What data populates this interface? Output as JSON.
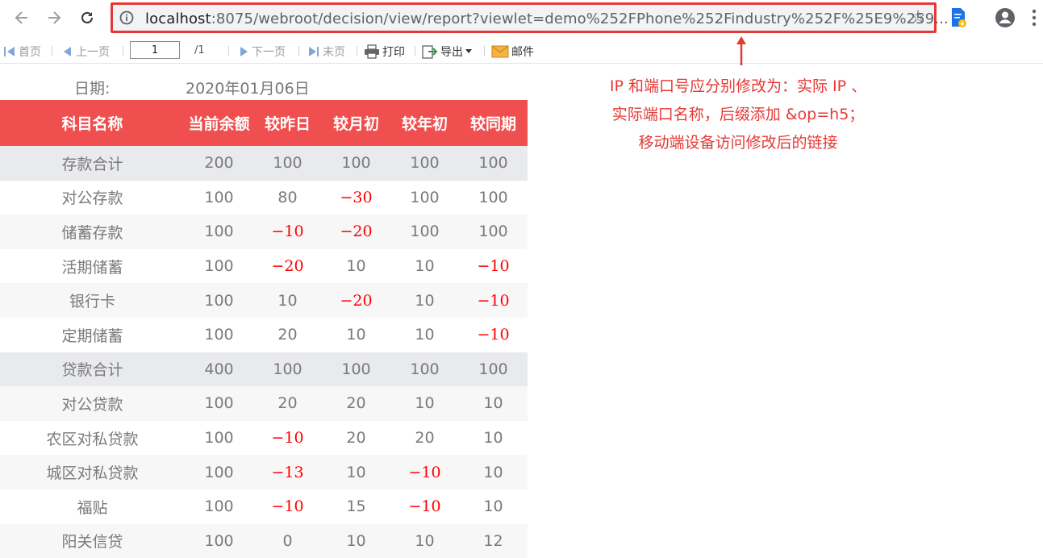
{
  "browser": {
    "url_host": "localhost",
    "url_rest": ":8075/webroot/decision/view/report?viewlet=demo%252FPhone%252Findustry%252F%25E9%259..."
  },
  "toolbar": {
    "first": "首页",
    "prev": "上一页",
    "page_value": "1",
    "page_total": "/1",
    "next": "下一页",
    "last": "末页",
    "print": "打印",
    "export": "导出",
    "mail": "邮件"
  },
  "report": {
    "date_label": "日期:",
    "date_value": "2020年01月06日",
    "columns": [
      "科目名称",
      "当前余额",
      "较昨日",
      "较月初",
      "较年初",
      "较同期"
    ],
    "rows": [
      {
        "type": "total",
        "name": "存款合计",
        "values": [
          "200",
          "100",
          "100",
          "100",
          "100"
        ],
        "neg": [
          false,
          false,
          false,
          false,
          false
        ]
      },
      {
        "type": "even",
        "name": "对公存款",
        "values": [
          "100",
          "80",
          "−30",
          "100",
          "100"
        ],
        "neg": [
          false,
          false,
          true,
          false,
          false
        ]
      },
      {
        "type": "odd",
        "name": "储蓄存款",
        "values": [
          "100",
          "−10",
          "−20",
          "100",
          "100"
        ],
        "neg": [
          false,
          true,
          true,
          false,
          false
        ]
      },
      {
        "type": "even",
        "name": "活期储蓄",
        "values": [
          "100",
          "−20",
          "10",
          "10",
          "−10"
        ],
        "neg": [
          false,
          true,
          false,
          false,
          true
        ]
      },
      {
        "type": "odd",
        "name": "银行卡",
        "values": [
          "100",
          "10",
          "−20",
          "10",
          "−10"
        ],
        "neg": [
          false,
          false,
          true,
          false,
          true
        ]
      },
      {
        "type": "even",
        "name": "定期储蓄",
        "values": [
          "100",
          "20",
          "10",
          "10",
          "−10"
        ],
        "neg": [
          false,
          false,
          false,
          false,
          true
        ]
      },
      {
        "type": "total",
        "name": "贷款合计",
        "values": [
          "400",
          "100",
          "100",
          "100",
          "100"
        ],
        "neg": [
          false,
          false,
          false,
          false,
          false
        ]
      },
      {
        "type": "odd",
        "name": "对公贷款",
        "values": [
          "100",
          "20",
          "20",
          "10",
          "10"
        ],
        "neg": [
          false,
          false,
          false,
          false,
          false
        ]
      },
      {
        "type": "even",
        "name": "农区对私贷款",
        "values": [
          "100",
          "−10",
          "20",
          "20",
          "10"
        ],
        "neg": [
          false,
          true,
          false,
          false,
          false
        ]
      },
      {
        "type": "odd",
        "name": "城区对私贷款",
        "values": [
          "100",
          "−13",
          "10",
          "−10",
          "10"
        ],
        "neg": [
          false,
          true,
          false,
          true,
          false
        ]
      },
      {
        "type": "even",
        "name": "福贴",
        "values": [
          "100",
          "−10",
          "15",
          "−10",
          "10"
        ],
        "neg": [
          false,
          true,
          false,
          true,
          false
        ]
      },
      {
        "type": "odd",
        "name": "阳关信贷",
        "values": [
          "100",
          "0",
          "10",
          "10",
          "12"
        ],
        "neg": [
          false,
          false,
          false,
          false,
          false
        ]
      }
    ]
  },
  "annotation": {
    "lines": [
      "IP 和端口号应分别修改为：实际 IP 、",
      "实际端口名称，后缀添加 &op=h5；",
      "移动端设备访问修改后的链接"
    ],
    "color": "#e53935"
  },
  "colors": {
    "header_bg": "#ef4f4f",
    "negative": "#ff0000",
    "total_row_bg": "#e9eaee",
    "highlight_border": "#e53935"
  }
}
